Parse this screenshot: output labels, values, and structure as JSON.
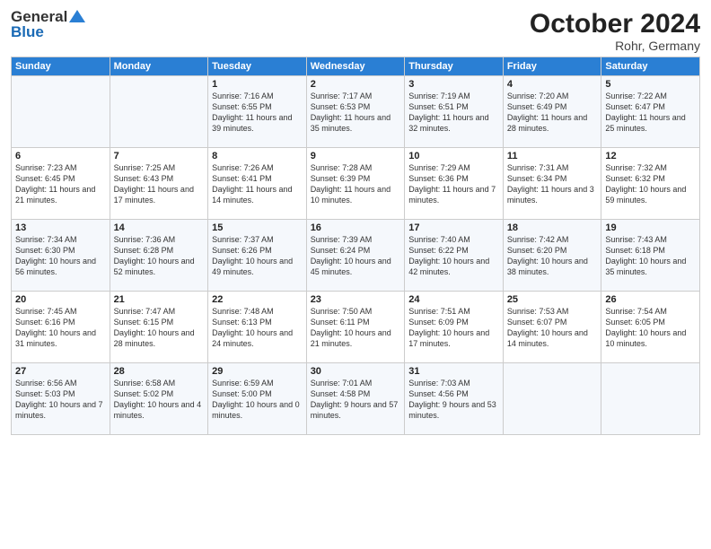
{
  "logo": {
    "general": "General",
    "blue": "Blue"
  },
  "title": "October 2024",
  "location": "Rohr, Germany",
  "days_of_week": [
    "Sunday",
    "Monday",
    "Tuesday",
    "Wednesday",
    "Thursday",
    "Friday",
    "Saturday"
  ],
  "weeks": [
    [
      {
        "day": "",
        "info": ""
      },
      {
        "day": "",
        "info": ""
      },
      {
        "day": "1",
        "info": "Sunrise: 7:16 AM\nSunset: 6:55 PM\nDaylight: 11 hours and 39 minutes."
      },
      {
        "day": "2",
        "info": "Sunrise: 7:17 AM\nSunset: 6:53 PM\nDaylight: 11 hours and 35 minutes."
      },
      {
        "day": "3",
        "info": "Sunrise: 7:19 AM\nSunset: 6:51 PM\nDaylight: 11 hours and 32 minutes."
      },
      {
        "day": "4",
        "info": "Sunrise: 7:20 AM\nSunset: 6:49 PM\nDaylight: 11 hours and 28 minutes."
      },
      {
        "day": "5",
        "info": "Sunrise: 7:22 AM\nSunset: 6:47 PM\nDaylight: 11 hours and 25 minutes."
      }
    ],
    [
      {
        "day": "6",
        "info": "Sunrise: 7:23 AM\nSunset: 6:45 PM\nDaylight: 11 hours and 21 minutes."
      },
      {
        "day": "7",
        "info": "Sunrise: 7:25 AM\nSunset: 6:43 PM\nDaylight: 11 hours and 17 minutes."
      },
      {
        "day": "8",
        "info": "Sunrise: 7:26 AM\nSunset: 6:41 PM\nDaylight: 11 hours and 14 minutes."
      },
      {
        "day": "9",
        "info": "Sunrise: 7:28 AM\nSunset: 6:39 PM\nDaylight: 11 hours and 10 minutes."
      },
      {
        "day": "10",
        "info": "Sunrise: 7:29 AM\nSunset: 6:36 PM\nDaylight: 11 hours and 7 minutes."
      },
      {
        "day": "11",
        "info": "Sunrise: 7:31 AM\nSunset: 6:34 PM\nDaylight: 11 hours and 3 minutes."
      },
      {
        "day": "12",
        "info": "Sunrise: 7:32 AM\nSunset: 6:32 PM\nDaylight: 10 hours and 59 minutes."
      }
    ],
    [
      {
        "day": "13",
        "info": "Sunrise: 7:34 AM\nSunset: 6:30 PM\nDaylight: 10 hours and 56 minutes."
      },
      {
        "day": "14",
        "info": "Sunrise: 7:36 AM\nSunset: 6:28 PM\nDaylight: 10 hours and 52 minutes."
      },
      {
        "day": "15",
        "info": "Sunrise: 7:37 AM\nSunset: 6:26 PM\nDaylight: 10 hours and 49 minutes."
      },
      {
        "day": "16",
        "info": "Sunrise: 7:39 AM\nSunset: 6:24 PM\nDaylight: 10 hours and 45 minutes."
      },
      {
        "day": "17",
        "info": "Sunrise: 7:40 AM\nSunset: 6:22 PM\nDaylight: 10 hours and 42 minutes."
      },
      {
        "day": "18",
        "info": "Sunrise: 7:42 AM\nSunset: 6:20 PM\nDaylight: 10 hours and 38 minutes."
      },
      {
        "day": "19",
        "info": "Sunrise: 7:43 AM\nSunset: 6:18 PM\nDaylight: 10 hours and 35 minutes."
      }
    ],
    [
      {
        "day": "20",
        "info": "Sunrise: 7:45 AM\nSunset: 6:16 PM\nDaylight: 10 hours and 31 minutes."
      },
      {
        "day": "21",
        "info": "Sunrise: 7:47 AM\nSunset: 6:15 PM\nDaylight: 10 hours and 28 minutes."
      },
      {
        "day": "22",
        "info": "Sunrise: 7:48 AM\nSunset: 6:13 PM\nDaylight: 10 hours and 24 minutes."
      },
      {
        "day": "23",
        "info": "Sunrise: 7:50 AM\nSunset: 6:11 PM\nDaylight: 10 hours and 21 minutes."
      },
      {
        "day": "24",
        "info": "Sunrise: 7:51 AM\nSunset: 6:09 PM\nDaylight: 10 hours and 17 minutes."
      },
      {
        "day": "25",
        "info": "Sunrise: 7:53 AM\nSunset: 6:07 PM\nDaylight: 10 hours and 14 minutes."
      },
      {
        "day": "26",
        "info": "Sunrise: 7:54 AM\nSunset: 6:05 PM\nDaylight: 10 hours and 10 minutes."
      }
    ],
    [
      {
        "day": "27",
        "info": "Sunrise: 6:56 AM\nSunset: 5:03 PM\nDaylight: 10 hours and 7 minutes."
      },
      {
        "day": "28",
        "info": "Sunrise: 6:58 AM\nSunset: 5:02 PM\nDaylight: 10 hours and 4 minutes."
      },
      {
        "day": "29",
        "info": "Sunrise: 6:59 AM\nSunset: 5:00 PM\nDaylight: 10 hours and 0 minutes."
      },
      {
        "day": "30",
        "info": "Sunrise: 7:01 AM\nSunset: 4:58 PM\nDaylight: 9 hours and 57 minutes."
      },
      {
        "day": "31",
        "info": "Sunrise: 7:03 AM\nSunset: 4:56 PM\nDaylight: 9 hours and 53 minutes."
      },
      {
        "day": "",
        "info": ""
      },
      {
        "day": "",
        "info": ""
      }
    ]
  ]
}
